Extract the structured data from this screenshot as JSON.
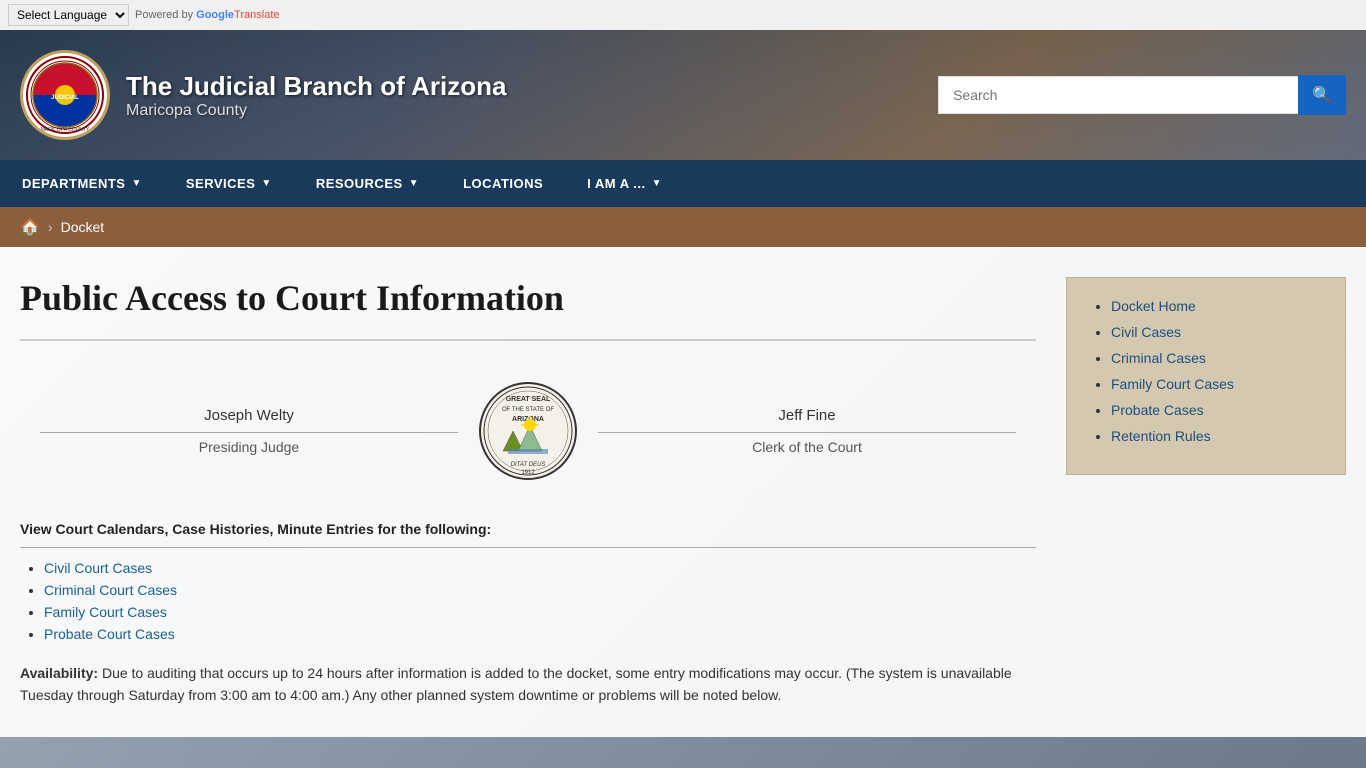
{
  "topbar": {
    "select_placeholder": "Select Language",
    "powered_by": "Powered by",
    "google": "Google",
    "translate": "Translate"
  },
  "header": {
    "title": "The Judicial Branch of Arizona",
    "subtitle": "Maricopa County",
    "search_placeholder": "Search"
  },
  "nav": {
    "items": [
      {
        "label": "DEPARTMENTS",
        "has_arrow": true
      },
      {
        "label": "SERVICES",
        "has_arrow": true
      },
      {
        "label": "RESOURCES",
        "has_arrow": true
      },
      {
        "label": "LOCATIONS",
        "has_arrow": false
      },
      {
        "label": "I AM A ...",
        "has_arrow": true
      }
    ]
  },
  "breadcrumb": {
    "home_icon": "🏠",
    "separator": "›",
    "current": "Docket"
  },
  "page": {
    "title": "Public Access to Court Information",
    "officer_left_name": "Joseph Welty",
    "officer_left_title": "Presiding Judge",
    "officer_right_name": "Jeff Fine",
    "officer_right_title": "Clerk of the Court",
    "court_links_heading": "View Court Calendars, Case Histories, Minute Entries for the following:",
    "court_links": [
      {
        "label": "Civil Court Cases",
        "href": "#"
      },
      {
        "label": "Criminal Court Cases",
        "href": "#"
      },
      {
        "label": "Family Court Cases",
        "href": "#"
      },
      {
        "label": "Probate Court Cases",
        "href": "#"
      }
    ],
    "availability_bold": "Availability:",
    "availability_text": " Due to auditing that occurs up to 24 hours after information is added to the docket, some entry modifications may occur. (The system is unavailable Tuesday through Saturday from 3:00 am to 4:00 am.) Any other planned system downtime or problems will be noted below."
  },
  "sidebar": {
    "links": [
      {
        "label": "Docket Home",
        "href": "#"
      },
      {
        "label": "Civil Cases",
        "href": "#"
      },
      {
        "label": "Criminal Cases",
        "href": "#"
      },
      {
        "label": "Family Court Cases",
        "href": "#"
      },
      {
        "label": "Probate Cases",
        "href": "#"
      },
      {
        "label": "Retention Rules",
        "href": "#"
      }
    ]
  }
}
